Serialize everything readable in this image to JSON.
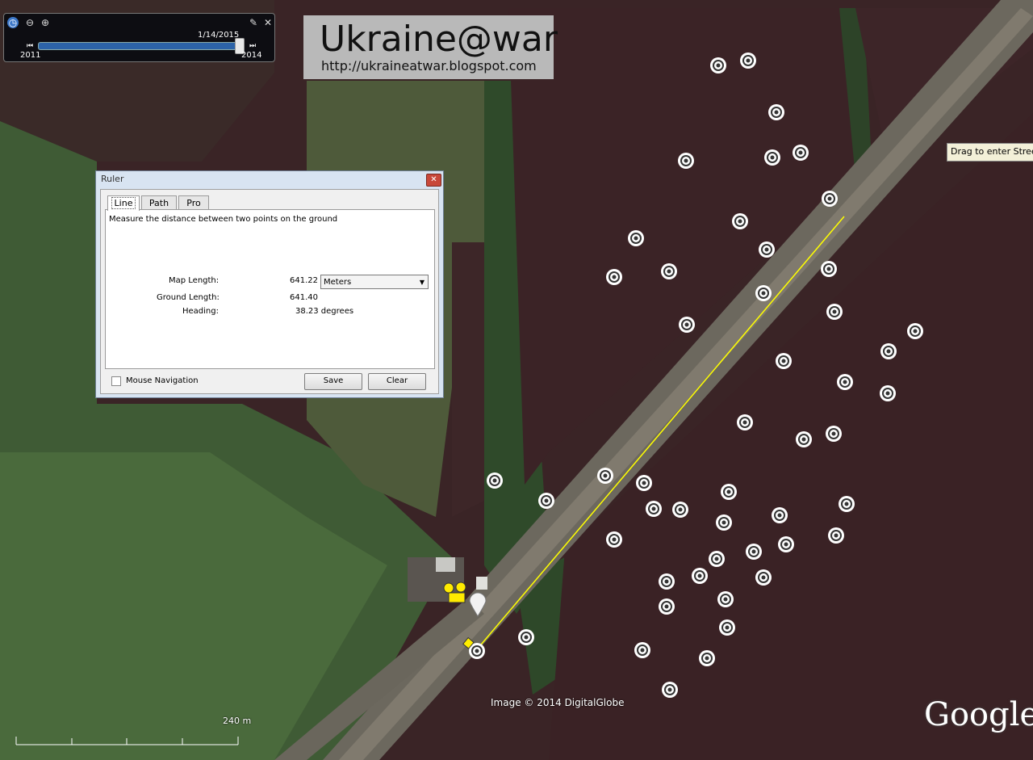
{
  "time_slider": {
    "current_date": "1/14/2015",
    "start_year": "2011",
    "end_year": "2014",
    "icons": [
      "clock-icon",
      "zoom-out-icon",
      "zoom-in-icon",
      "wrench-icon",
      "close-icon"
    ]
  },
  "watermark": {
    "title": "Ukraine@war",
    "url": "http://ukraineatwar.blogspot.com"
  },
  "tooltip": "Drag to enter Street",
  "ruler": {
    "title": "Ruler",
    "tabs": [
      "Line",
      "Path",
      "Pro"
    ],
    "active_tab": "Line",
    "description": "Measure the distance between two points on the ground",
    "map_length_label": "Map Length:",
    "map_length_value": "641.22",
    "unit": "Meters",
    "ground_length_label": "Ground Length:",
    "ground_length_value": "641.40",
    "heading_label": "Heading:",
    "heading_value": "38.23 degrees",
    "mouse_navigation": "Mouse Navigation",
    "save_label": "Save",
    "clear_label": "Clear"
  },
  "map": {
    "copyright": "Image © 2014 DigitalGlobe",
    "logo": "Google",
    "scale_label": "240 m",
    "colors": {
      "field_dark": "#3a2426",
      "field_green": "#3e5a34",
      "road": "#6e6a60",
      "ruler_line": "#ffff00",
      "annotation": "#e8141e"
    }
  }
}
